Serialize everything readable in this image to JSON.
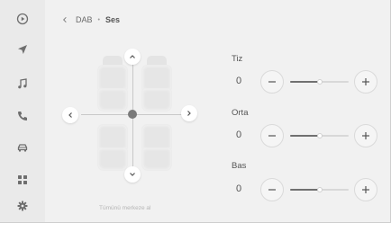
{
  "header": {
    "back_label": "<",
    "source": "DAB",
    "separator": "•",
    "title": "Ses"
  },
  "sidebar": {
    "items": [
      {
        "name": "media-play-icon"
      },
      {
        "name": "navigation-icon"
      },
      {
        "name": "music-icon",
        "active": true
      },
      {
        "name": "phone-icon"
      },
      {
        "name": "car-icon"
      },
      {
        "name": "apps-grid-icon"
      },
      {
        "name": "settings-gear-icon"
      }
    ]
  },
  "balance": {
    "reset_label": "Tümünü merkeze al",
    "fader_position": 0,
    "balance_position": 0
  },
  "equalizer": {
    "bands": [
      {
        "label": "Tiz",
        "value": "0",
        "level": 0.5
      },
      {
        "label": "Orta",
        "value": "0",
        "level": 0.5
      },
      {
        "label": "Bas",
        "value": "0",
        "level": 0.5
      }
    ]
  },
  "colors": {
    "background": "#f1f1f1",
    "sidebar": "#eaeaea",
    "slider_fill": "#707070",
    "icon": "#6e6e6e"
  }
}
